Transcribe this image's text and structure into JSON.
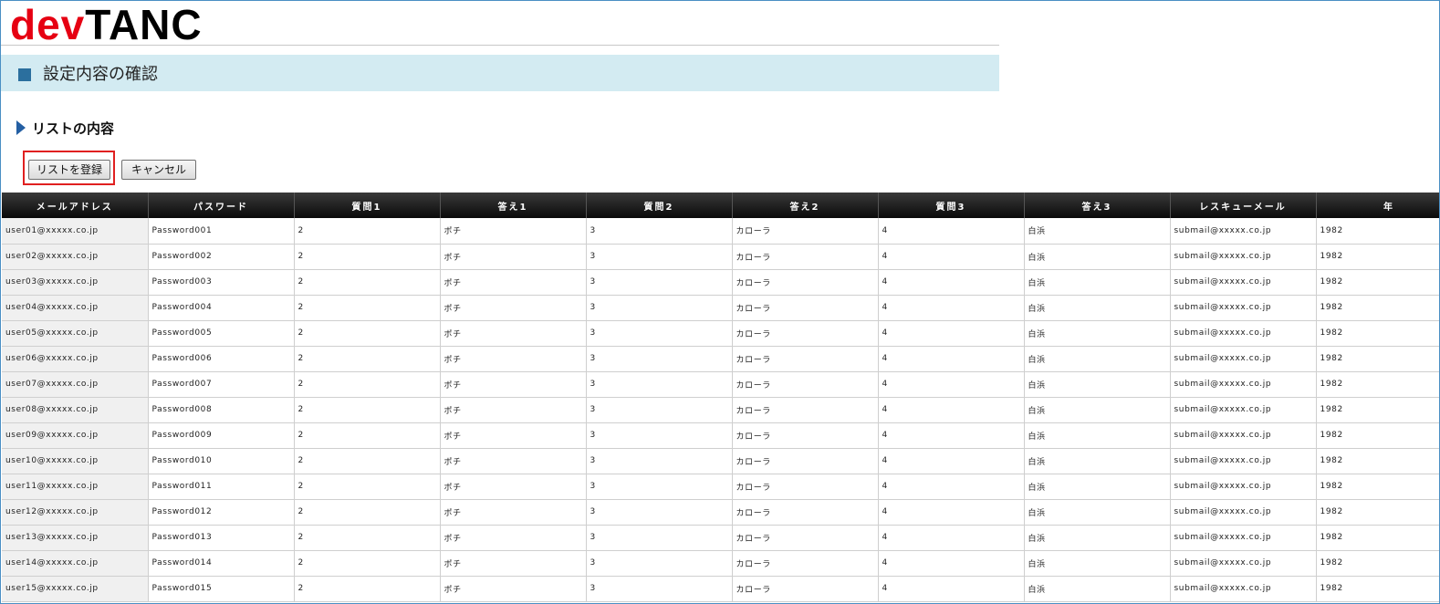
{
  "logo": {
    "part1": "dev",
    "part2": "TANC"
  },
  "page_title": "設定内容の確認",
  "section_title": "リストの内容",
  "buttons": {
    "register": "リストを登録",
    "cancel": "キャンセル"
  },
  "table": {
    "headers": [
      "メールアドレス",
      "パスワード",
      "質問1",
      "答え1",
      "質問2",
      "答え2",
      "質問3",
      "答え3",
      "レスキューメール",
      "年"
    ],
    "rows": [
      [
        "user01@xxxxx.co.jp",
        "Password001",
        "2",
        "ポチ",
        "3",
        "カローラ",
        "4",
        "白浜",
        "submail@xxxxx.co.jp",
        "1982"
      ],
      [
        "user02@xxxxx.co.jp",
        "Password002",
        "2",
        "ポチ",
        "3",
        "カローラ",
        "4",
        "白浜",
        "submail@xxxxx.co.jp",
        "1982"
      ],
      [
        "user03@xxxxx.co.jp",
        "Password003",
        "2",
        "ポチ",
        "3",
        "カローラ",
        "4",
        "白浜",
        "submail@xxxxx.co.jp",
        "1982"
      ],
      [
        "user04@xxxxx.co.jp",
        "Password004",
        "2",
        "ポチ",
        "3",
        "カローラ",
        "4",
        "白浜",
        "submail@xxxxx.co.jp",
        "1982"
      ],
      [
        "user05@xxxxx.co.jp",
        "Password005",
        "2",
        "ポチ",
        "3",
        "カローラ",
        "4",
        "白浜",
        "submail@xxxxx.co.jp",
        "1982"
      ],
      [
        "user06@xxxxx.co.jp",
        "Password006",
        "2",
        "ポチ",
        "3",
        "カローラ",
        "4",
        "白浜",
        "submail@xxxxx.co.jp",
        "1982"
      ],
      [
        "user07@xxxxx.co.jp",
        "Password007",
        "2",
        "ポチ",
        "3",
        "カローラ",
        "4",
        "白浜",
        "submail@xxxxx.co.jp",
        "1982"
      ],
      [
        "user08@xxxxx.co.jp",
        "Password008",
        "2",
        "ポチ",
        "3",
        "カローラ",
        "4",
        "白浜",
        "submail@xxxxx.co.jp",
        "1982"
      ],
      [
        "user09@xxxxx.co.jp",
        "Password009",
        "2",
        "ポチ",
        "3",
        "カローラ",
        "4",
        "白浜",
        "submail@xxxxx.co.jp",
        "1982"
      ],
      [
        "user10@xxxxx.co.jp",
        "Password010",
        "2",
        "ポチ",
        "3",
        "カローラ",
        "4",
        "白浜",
        "submail@xxxxx.co.jp",
        "1982"
      ],
      [
        "user11@xxxxx.co.jp",
        "Password011",
        "2",
        "ポチ",
        "3",
        "カローラ",
        "4",
        "白浜",
        "submail@xxxxx.co.jp",
        "1982"
      ],
      [
        "user12@xxxxx.co.jp",
        "Password012",
        "2",
        "ポチ",
        "3",
        "カローラ",
        "4",
        "白浜",
        "submail@xxxxx.co.jp",
        "1982"
      ],
      [
        "user13@xxxxx.co.jp",
        "Password013",
        "2",
        "ポチ",
        "3",
        "カローラ",
        "4",
        "白浜",
        "submail@xxxxx.co.jp",
        "1982"
      ],
      [
        "user14@xxxxx.co.jp",
        "Password014",
        "2",
        "ポチ",
        "3",
        "カローラ",
        "4",
        "白浜",
        "submail@xxxxx.co.jp",
        "1982"
      ],
      [
        "user15@xxxxx.co.jp",
        "Password015",
        "2",
        "ポチ",
        "3",
        "カローラ",
        "4",
        "白浜",
        "submail@xxxxx.co.jp",
        "1982"
      ]
    ]
  },
  "colors": {
    "logo_accent": "#e60012",
    "title_bar": "#d3ebf2",
    "highlight_border": "#e02020",
    "table_header": "#1a1a1a"
  }
}
